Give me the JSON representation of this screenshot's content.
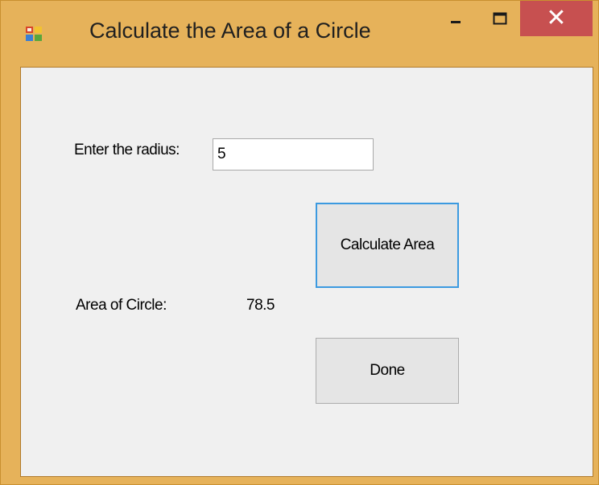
{
  "window": {
    "title": "Calculate the Area of a Circle",
    "icon": "winforms-app-icon",
    "controls": {
      "minimize_icon": "minimize-icon",
      "maximize_icon": "maximize-icon",
      "close_icon": "close-icon",
      "close_glyph": "✕"
    }
  },
  "form": {
    "radius_label": "Enter the radius:",
    "radius_value": "5",
    "calculate_label": "Calculate Area",
    "area_label": "Area of Circle:",
    "area_value": "78.5",
    "done_label": "Done"
  },
  "colors": {
    "window_frame": "#e6b25a",
    "close_button": "#c75050",
    "client_background": "#f0f0f0",
    "focused_button_border": "#3c9ae0"
  }
}
